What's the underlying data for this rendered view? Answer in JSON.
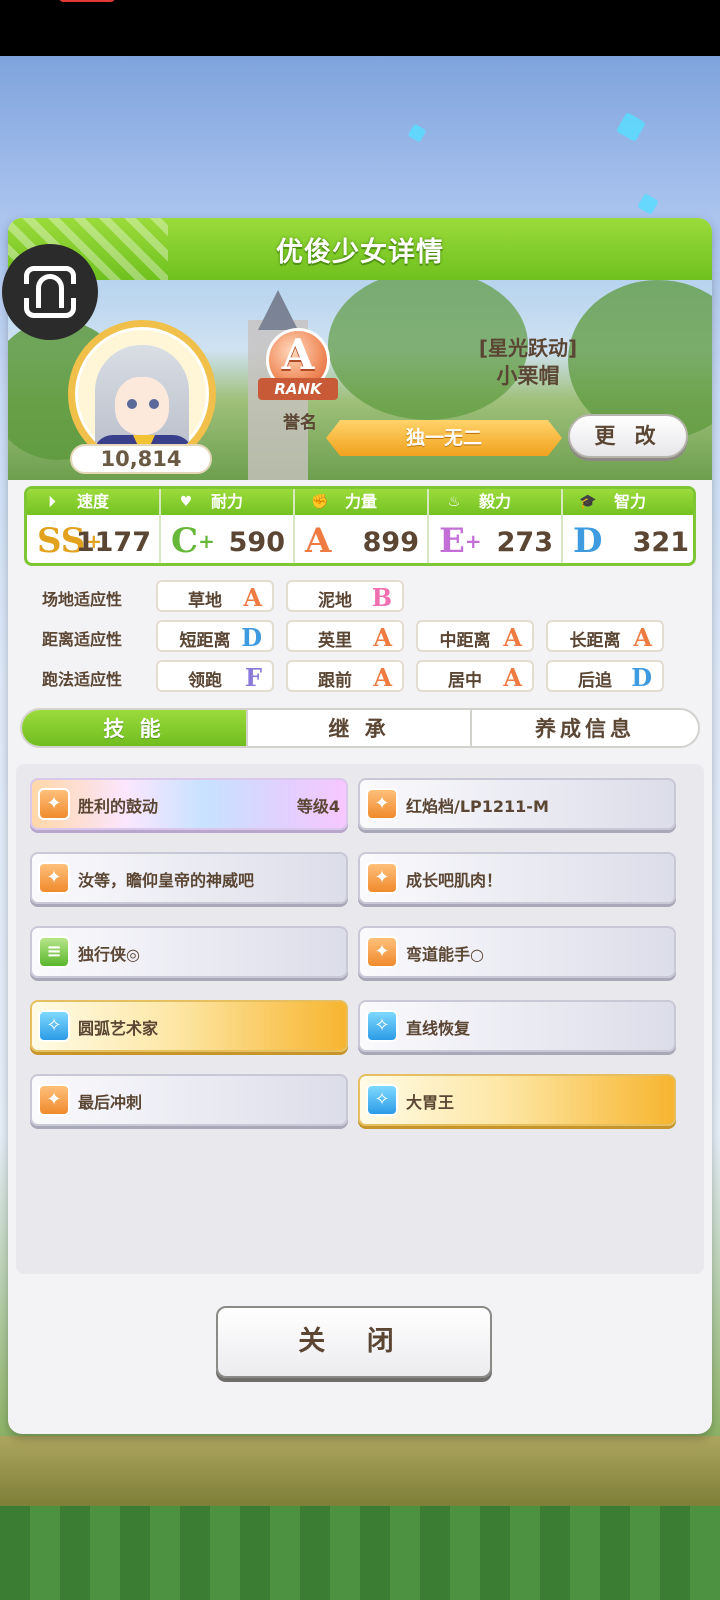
{
  "header": {
    "title": "优俊少女详情"
  },
  "profile": {
    "score": "10,814",
    "rank_grade": "A",
    "rank_ribbon": "RANK",
    "rank_label": "誉名",
    "epithet": "[星光跃动]",
    "name": "小栗帽",
    "title_badge": "独一无二",
    "change_button": "更 改"
  },
  "stats": [
    {
      "label": "速度",
      "icon": "speed-icon",
      "grade": "SS",
      "plus": "+",
      "value": "1177",
      "color": "#e2a21f"
    },
    {
      "label": "耐力",
      "icon": "heart-icon",
      "grade": "C",
      "plus": "+",
      "value": "590",
      "color": "#67b83a"
    },
    {
      "label": "力量",
      "icon": "arm-icon",
      "grade": "A",
      "plus": "",
      "value": "899",
      "color": "#ef7a42"
    },
    {
      "label": "毅力",
      "icon": "flame-icon",
      "grade": "E",
      "plus": "+",
      "value": "273",
      "color": "#c46fd8"
    },
    {
      "label": "智力",
      "icon": "graduation-cap-icon",
      "grade": "D",
      "plus": "",
      "value": "321",
      "color": "#3e9be0"
    }
  ],
  "aptitude": {
    "track_label": "场地适应性",
    "distance_label": "距离适应性",
    "style_label": "跑法适应性",
    "track": [
      {
        "name": "草地",
        "grade": "A"
      },
      {
        "name": "泥地",
        "grade": "B"
      }
    ],
    "distance": [
      {
        "name": "短距离",
        "grade": "D"
      },
      {
        "name": "英里",
        "grade": "A"
      },
      {
        "name": "中距离",
        "grade": "A"
      },
      {
        "name": "长距离",
        "grade": "A"
      }
    ],
    "style": [
      {
        "name": "领跑",
        "grade": "F"
      },
      {
        "name": "跟前",
        "grade": "A"
      },
      {
        "name": "居中",
        "grade": "A"
      },
      {
        "name": "后追",
        "grade": "D"
      }
    ]
  },
  "grade_colors": {
    "A": "#ef7a42",
    "B": "#f06fb0",
    "D": "#3e9be0",
    "F": "#8c7ad8"
  },
  "tabs": [
    {
      "label": "技 能",
      "active": true
    },
    {
      "label": "继 承",
      "active": false
    },
    {
      "label": "养成信息",
      "active": false
    }
  ],
  "skills": [
    {
      "name": "胜利的鼓动",
      "level": "等级4",
      "style": "rainbow",
      "icon": "orange"
    },
    {
      "name": "红焰档/LP1211-M",
      "level": "",
      "style": "plain",
      "icon": "orange"
    },
    {
      "name": "汝等，瞻仰皇帝的神威吧",
      "level": "",
      "style": "plain",
      "icon": "orange"
    },
    {
      "name": "成长吧肌肉！",
      "level": "",
      "style": "plain",
      "icon": "orange"
    },
    {
      "name": "独行侠◎",
      "level": "",
      "style": "plain",
      "icon": "green"
    },
    {
      "name": "弯道能手○",
      "level": "",
      "style": "plain",
      "icon": "orange"
    },
    {
      "name": "圆弧艺术家",
      "level": "",
      "style": "gold",
      "icon": "blue"
    },
    {
      "name": "直线恢复",
      "level": "",
      "style": "plain",
      "icon": "blue"
    },
    {
      "name": "最后冲刺",
      "level": "",
      "style": "plain",
      "icon": "orange"
    },
    {
      "name": "大胃王",
      "level": "",
      "style": "gold",
      "icon": "blue"
    }
  ],
  "close_button": "关 闭"
}
